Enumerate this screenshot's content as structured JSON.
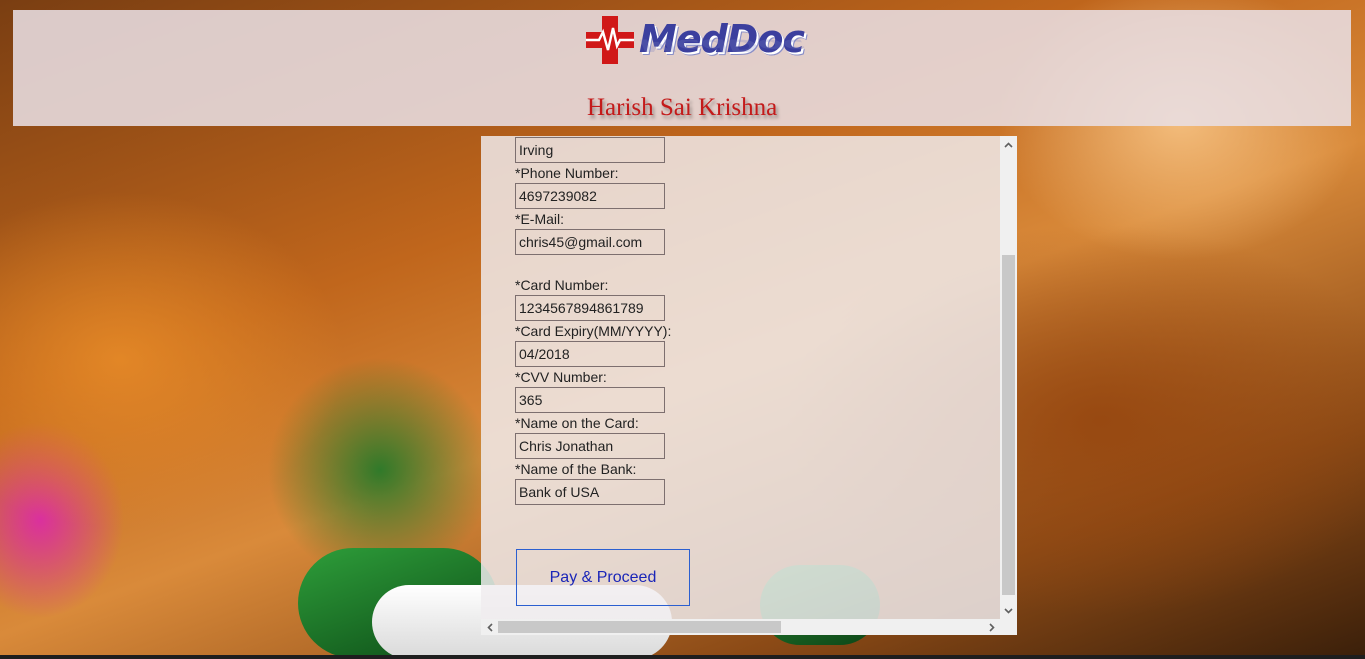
{
  "app": {
    "logo_text": "MedDoc",
    "user_name": "Harish Sai Krishna"
  },
  "form": {
    "city_value": "Irving",
    "phone_label": "*Phone Number:",
    "phone_value": "4697239082",
    "email_label": "*E-Mail:",
    "email_value": "chris45@gmail.com",
    "card_number_label": "*Card Number:",
    "card_number_value": "1234567894861789",
    "card_expiry_label": "*Card Expiry(MM/YYYY):",
    "card_expiry_value": "04/2018",
    "cvv_label": "*CVV Number:",
    "cvv_value": "365",
    "card_name_label": "*Name on the Card:",
    "card_name_value": "Chris Jonathan",
    "bank_name_label": "*Name of the Bank:",
    "bank_name_value": "Bank of USA",
    "submit_label": "Pay & Proceed"
  },
  "icons": {
    "logo": "medical-cross-heartbeat-icon",
    "scroll_up": "chevron-up-icon",
    "scroll_down": "chevron-down-icon",
    "scroll_left": "chevron-left-icon",
    "scroll_right": "chevron-right-icon"
  },
  "colors": {
    "brand_red": "#d01818",
    "brand_blue": "#3b3f9e",
    "user_name": "#c41a1a",
    "button_text": "#1a25b8",
    "button_border": "#2b5fd0"
  }
}
